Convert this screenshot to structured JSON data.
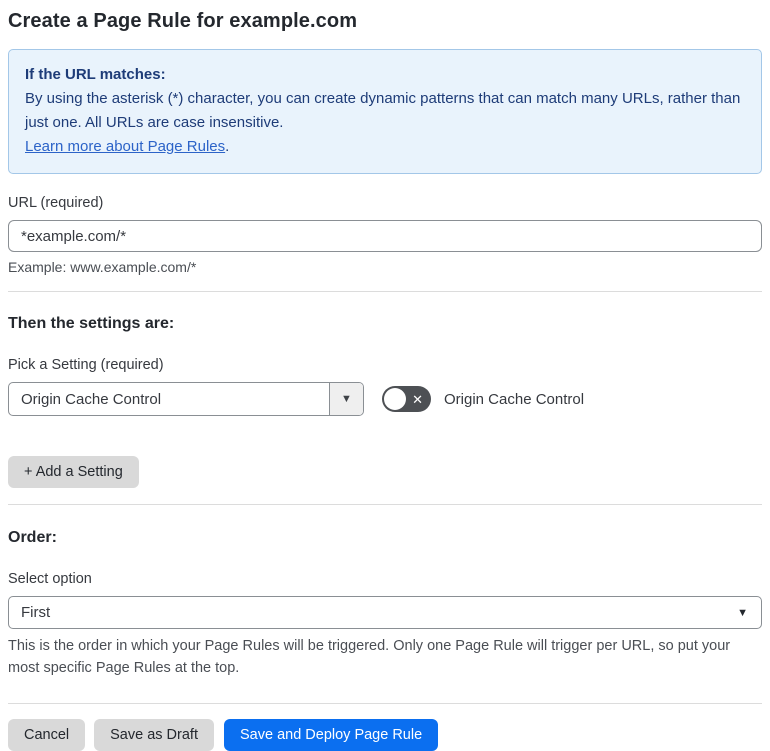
{
  "page": {
    "title": "Create a Page Rule for example.com"
  },
  "info_box": {
    "heading": "If the URL matches:",
    "body": "By using the asterisk (*) character, you can create dynamic patterns that can match many URLs, rather than just one. All URLs are case insensitive.",
    "link_label": "Learn more about Page Rules",
    "link_suffix": "."
  },
  "url_field": {
    "label": "URL (required)",
    "value": "*example.com/*",
    "helper": "Example: www.example.com/*"
  },
  "settings_section": {
    "heading": "Then the settings are:",
    "picker_label": "Pick a Setting (required)",
    "picker_value": "Origin Cache Control",
    "toggle_label": "Origin Cache Control",
    "toggle_state": "off",
    "add_setting_label": "+ Add a Setting"
  },
  "order_section": {
    "heading": "Order:",
    "select_label": "Select option",
    "select_value": "First",
    "helper": "This is the order in which your Page Rules will be triggered. Only one Page Rule will trigger per URL, so put your most specific Page Rules at the top."
  },
  "footer": {
    "cancel_label": "Cancel",
    "save_draft_label": "Save as Draft",
    "save_deploy_label": "Save and Deploy Page Rule"
  },
  "icons": {
    "caret_down": "▼",
    "toggle_off_x": "✕"
  },
  "colors": {
    "info_bg": "#e9f3fc",
    "info_border": "#a3c7e8",
    "info_text": "#1e3c78",
    "link_blue": "#2c63c8",
    "primary_button_blue": "#0b6ff0",
    "secondary_button_gray": "#d9d9d9",
    "toggle_off_bg": "#4d5054"
  }
}
